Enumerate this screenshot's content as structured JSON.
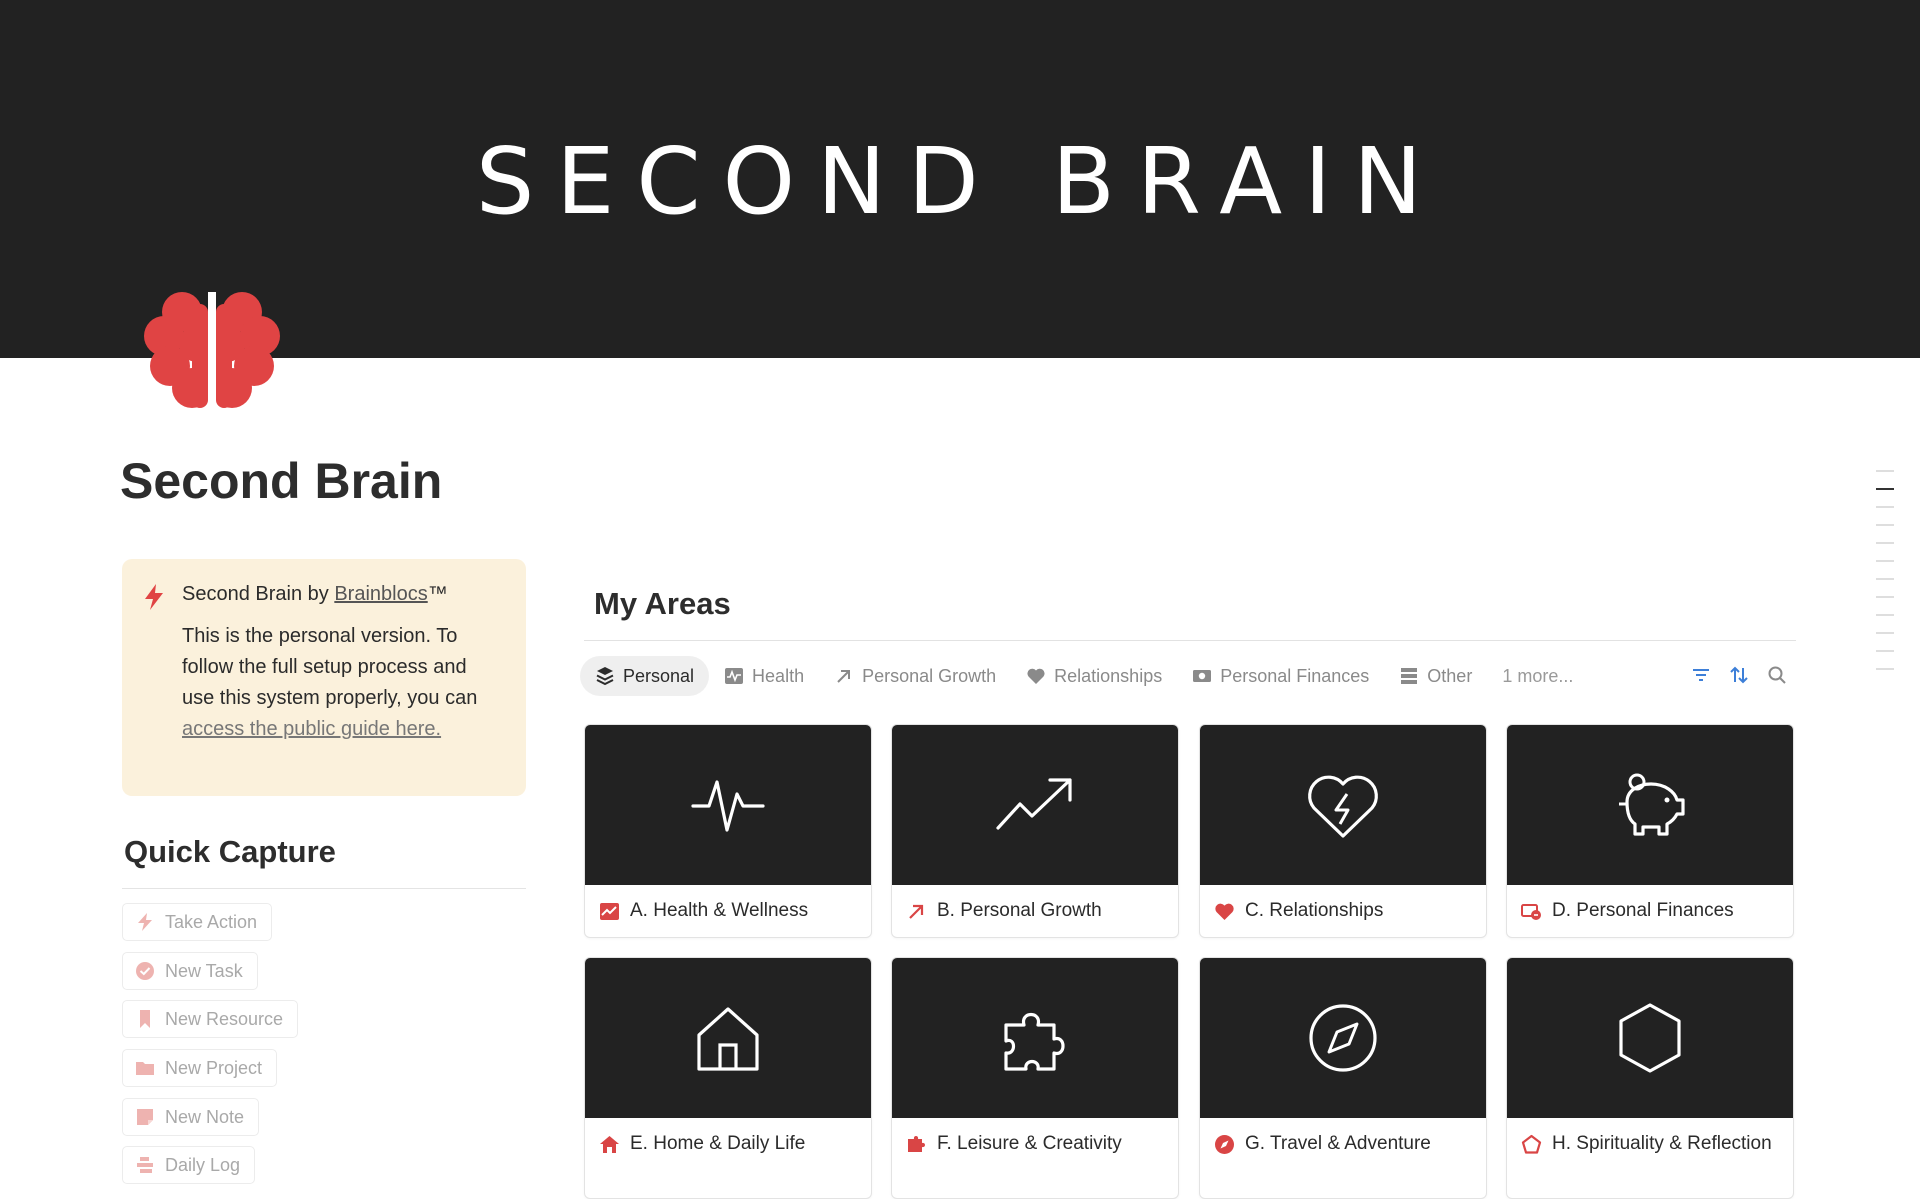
{
  "cover": {
    "title": "SECOND BRAIN"
  },
  "page": {
    "title": "Second Brain",
    "icon": "brain-icon",
    "accent": "#e04444"
  },
  "callout": {
    "icon": "bolt-icon",
    "head_prefix": "Second Brain by ",
    "head_link": "Brainblocs",
    "head_suffix": "™",
    "body_text": "This is the personal version. To follow the full setup process and use this system properly, you can ",
    "body_link": "access the public guide here."
  },
  "quick_capture": {
    "title": "Quick Capture",
    "buttons": [
      {
        "label": "Take Action",
        "icon": "bolt-icon"
      },
      {
        "label": "New Task",
        "icon": "check-circle-icon"
      },
      {
        "label": "New Resource",
        "icon": "bookmark-icon"
      },
      {
        "label": "New Project",
        "icon": "folder-icon"
      },
      {
        "label": "New Note",
        "icon": "note-icon"
      },
      {
        "label": "Daily Log",
        "icon": "log-icon"
      }
    ]
  },
  "areas": {
    "title": "My Areas",
    "tabs": [
      {
        "label": "Personal",
        "icon": "layers-icon",
        "active": true
      },
      {
        "label": "Health",
        "icon": "activity-icon"
      },
      {
        "label": "Personal Growth",
        "icon": "arrow-up-right-icon"
      },
      {
        "label": "Relationships",
        "icon": "heart-icon"
      },
      {
        "label": "Personal Finances",
        "icon": "money-icon"
      },
      {
        "label": "Other",
        "icon": "list-icon"
      }
    ],
    "more_label": "1 more...",
    "toolbar": [
      "filter-icon",
      "sort-icon",
      "search-icon"
    ],
    "cards": [
      {
        "label": "A. Health & Wellness",
        "cover_icon": "pulse-icon",
        "icon": "chart-icon"
      },
      {
        "label": "B. Personal Growth",
        "cover_icon": "trending-up-icon",
        "icon": "arrow-up-right-icon"
      },
      {
        "label": "C. Relationships",
        "cover_icon": "heart-bolt-icon",
        "icon": "heart-icon"
      },
      {
        "label": "D. Personal Finances",
        "cover_icon": "piggy-bank-icon",
        "icon": "money-icon"
      },
      {
        "label": "E. Home & Daily Life",
        "cover_icon": "home-icon",
        "icon": "home-icon"
      },
      {
        "label": "F. Leisure & Creativity",
        "cover_icon": "puzzle-icon",
        "icon": "puzzle-icon"
      },
      {
        "label": "G. Travel & Adventure",
        "cover_icon": "compass-icon",
        "icon": "compass-icon"
      },
      {
        "label": "H. Spirituality & Reflection",
        "cover_icon": "hexagon-icon",
        "icon": "pentagon-icon"
      }
    ]
  }
}
